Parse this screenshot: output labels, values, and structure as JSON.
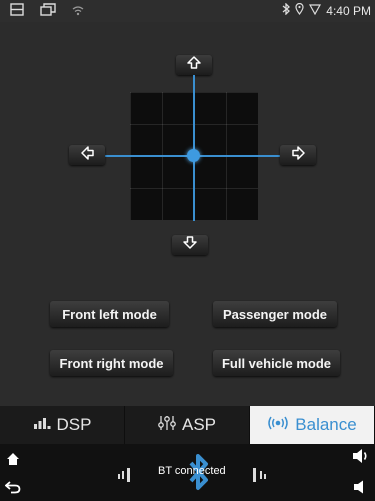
{
  "status": {
    "time": "4:40 PM",
    "icons": [
      "window-icon",
      "multiwindow-icon",
      "wifi-icon",
      "bluetooth-icon",
      "location-icon",
      "signal-icon"
    ]
  },
  "balance": {
    "arrows": [
      "up-arrow-icon",
      "left-arrow-icon",
      "right-arrow-icon",
      "down-arrow-icon"
    ]
  },
  "modes": {
    "front_left": "Front left mode",
    "passenger": "Passenger mode",
    "front_right": "Front right mode",
    "full_vehicle": "Full vehicle mode"
  },
  "tabs": {
    "dsp": "DSP",
    "asp": "ASP",
    "balance": "Balance",
    "active": "Balance"
  },
  "bottom_bar": {
    "bt_status": "BT connected"
  },
  "colors": {
    "accent": "#3a8fd0",
    "background": "#2c2c2c",
    "active_tab": "#f2f2f2"
  }
}
